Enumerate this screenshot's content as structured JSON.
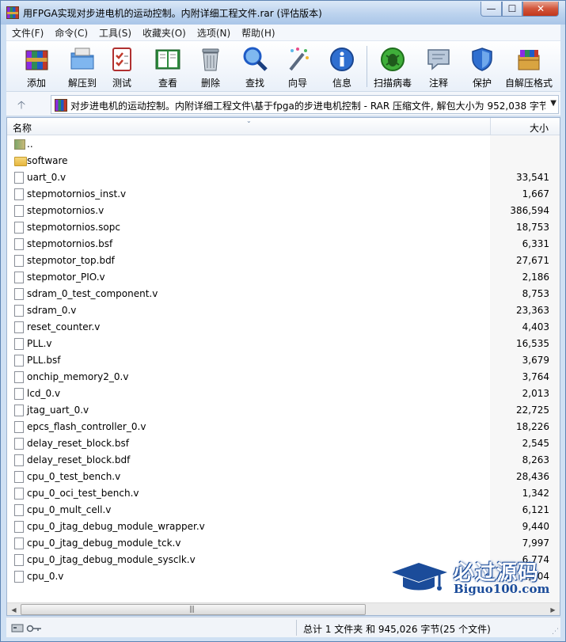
{
  "window": {
    "title": "用FPGA实现对步进电机的运动控制。内附详细工程文件.rar (评估版本)",
    "controls": {
      "minimize": "—",
      "maximize": "☐",
      "close": "✕"
    }
  },
  "menu": [
    "文件(F)",
    "命令(C)",
    "工具(S)",
    "收藏夹(O)",
    "选项(N)",
    "帮助(H)"
  ],
  "toolbar": [
    {
      "label": "添加",
      "icon": "archive-add-icon"
    },
    {
      "label": "解压到",
      "icon": "extract-folder-icon"
    },
    {
      "label": "测试",
      "icon": "test-checklist-icon"
    },
    {
      "label": "查看",
      "icon": "view-book-icon"
    },
    {
      "label": "删除",
      "icon": "trash-icon"
    },
    {
      "label": "查找",
      "icon": "magnifier-icon"
    },
    {
      "label": "向导",
      "icon": "wizard-wand-icon"
    },
    {
      "label": "信息",
      "icon": "info-icon"
    },
    {
      "label": "扫描病毒",
      "icon": "virus-scan-icon"
    },
    {
      "label": "注释",
      "icon": "comment-icon"
    },
    {
      "label": "保护",
      "icon": "shield-icon"
    },
    {
      "label": "自解压格式",
      "icon": "sfx-box-icon"
    }
  ],
  "address": {
    "up": "🡡",
    "path": "对步进电机的运动控制。内附详细工程文件\\基于fpga的步进电机控制 - RAR 压缩文件, 解包大小为 952,038 字节",
    "dropdown": "▼"
  },
  "columns": {
    "name": "名称",
    "size": "大小",
    "sort": "⌄"
  },
  "files": [
    {
      "name": "..",
      "size": "",
      "type": "parent"
    },
    {
      "name": "software",
      "size": "",
      "type": "folder"
    },
    {
      "name": "uart_0.v",
      "size": "33,541",
      "type": "file"
    },
    {
      "name": "stepmotornios_inst.v",
      "size": "1,667",
      "type": "file"
    },
    {
      "name": "stepmotornios.v",
      "size": "386,594",
      "type": "file"
    },
    {
      "name": "stepmotornios.sopc",
      "size": "18,753",
      "type": "file"
    },
    {
      "name": "stepmotornios.bsf",
      "size": "6,331",
      "type": "file"
    },
    {
      "name": "stepmotor_top.bdf",
      "size": "27,671",
      "type": "file"
    },
    {
      "name": "stepmotor_PIO.v",
      "size": "2,186",
      "type": "file"
    },
    {
      "name": "sdram_0_test_component.v",
      "size": "8,753",
      "type": "file"
    },
    {
      "name": "sdram_0.v",
      "size": "23,363",
      "type": "file"
    },
    {
      "name": "reset_counter.v",
      "size": "4,403",
      "type": "file"
    },
    {
      "name": "PLL.v",
      "size": "16,535",
      "type": "file"
    },
    {
      "name": "PLL.bsf",
      "size": "3,679",
      "type": "file"
    },
    {
      "name": "onchip_memory2_0.v",
      "size": "3,764",
      "type": "file"
    },
    {
      "name": "lcd_0.v",
      "size": "2,013",
      "type": "file"
    },
    {
      "name": "jtag_uart_0.v",
      "size": "22,725",
      "type": "file"
    },
    {
      "name": "epcs_flash_controller_0.v",
      "size": "18,226",
      "type": "file"
    },
    {
      "name": "delay_reset_block.bsf",
      "size": "2,545",
      "type": "file"
    },
    {
      "name": "delay_reset_block.bdf",
      "size": "8,263",
      "type": "file"
    },
    {
      "name": "cpu_0_test_bench.v",
      "size": "28,436",
      "type": "file"
    },
    {
      "name": "cpu_0_oci_test_bench.v",
      "size": "1,342",
      "type": "file"
    },
    {
      "name": "cpu_0_mult_cell.v",
      "size": "6,121",
      "type": "file"
    },
    {
      "name": "cpu_0_jtag_debug_module_wrapper.v",
      "size": "9,440",
      "type": "file"
    },
    {
      "name": "cpu_0_jtag_debug_module_tck.v",
      "size": "7,997",
      "type": "file"
    },
    {
      "name": "cpu_0_jtag_debug_module_sysclk.v",
      "size": "6,774",
      "type": "file"
    },
    {
      "name": "cpu_0.v",
      "size": "1,904",
      "type": "file"
    }
  ],
  "scrollbar": {
    "left": "◀",
    "right": "▶",
    "grip": "|||"
  },
  "watermark": {
    "title": "必过源码",
    "subtitle": "Biguo100.com"
  },
  "status": {
    "summary": "总计 1 文件夹 和 945,026 字节(25 个文件)",
    "grip": "⋰"
  },
  "colors": {
    "accent": "#1b4c9a",
    "titlebar": "#bcd3ee",
    "close": "#c1371c"
  }
}
